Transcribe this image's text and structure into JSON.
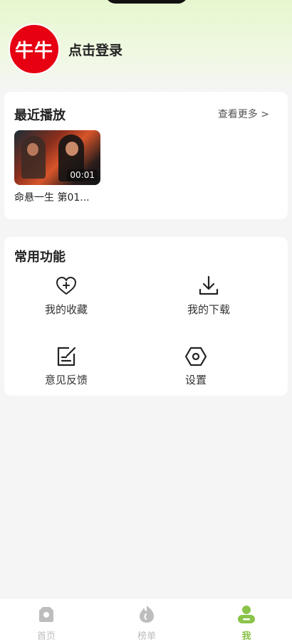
{
  "profile": {
    "avatar_text": "牛牛",
    "login_label": "点击登录"
  },
  "recent": {
    "title": "最近播放",
    "more_label": "查看更多 >",
    "item": {
      "title": "命悬一生 第01...",
      "duration": "00:01"
    }
  },
  "functions": {
    "title": "常用功能",
    "items": [
      {
        "label": "我的收藏",
        "icon": "heart-plus-icon"
      },
      {
        "label": "我的下载",
        "icon": "download-icon"
      },
      {
        "label": "意见反馈",
        "icon": "feedback-icon"
      },
      {
        "label": "设置",
        "icon": "hexagon-settings-icon"
      }
    ]
  },
  "tabbar": {
    "items": [
      {
        "label": "首页",
        "icon": "home-icon",
        "active": false
      },
      {
        "label": "榜单",
        "icon": "flame-icon",
        "active": false
      },
      {
        "label": "我",
        "icon": "user-icon",
        "active": true
      }
    ],
    "active_color": "#8bc34a",
    "inactive_color": "#bdbdbd"
  },
  "colors": {
    "avatar_bg": "#e60012",
    "accent": "#8bc34a"
  }
}
